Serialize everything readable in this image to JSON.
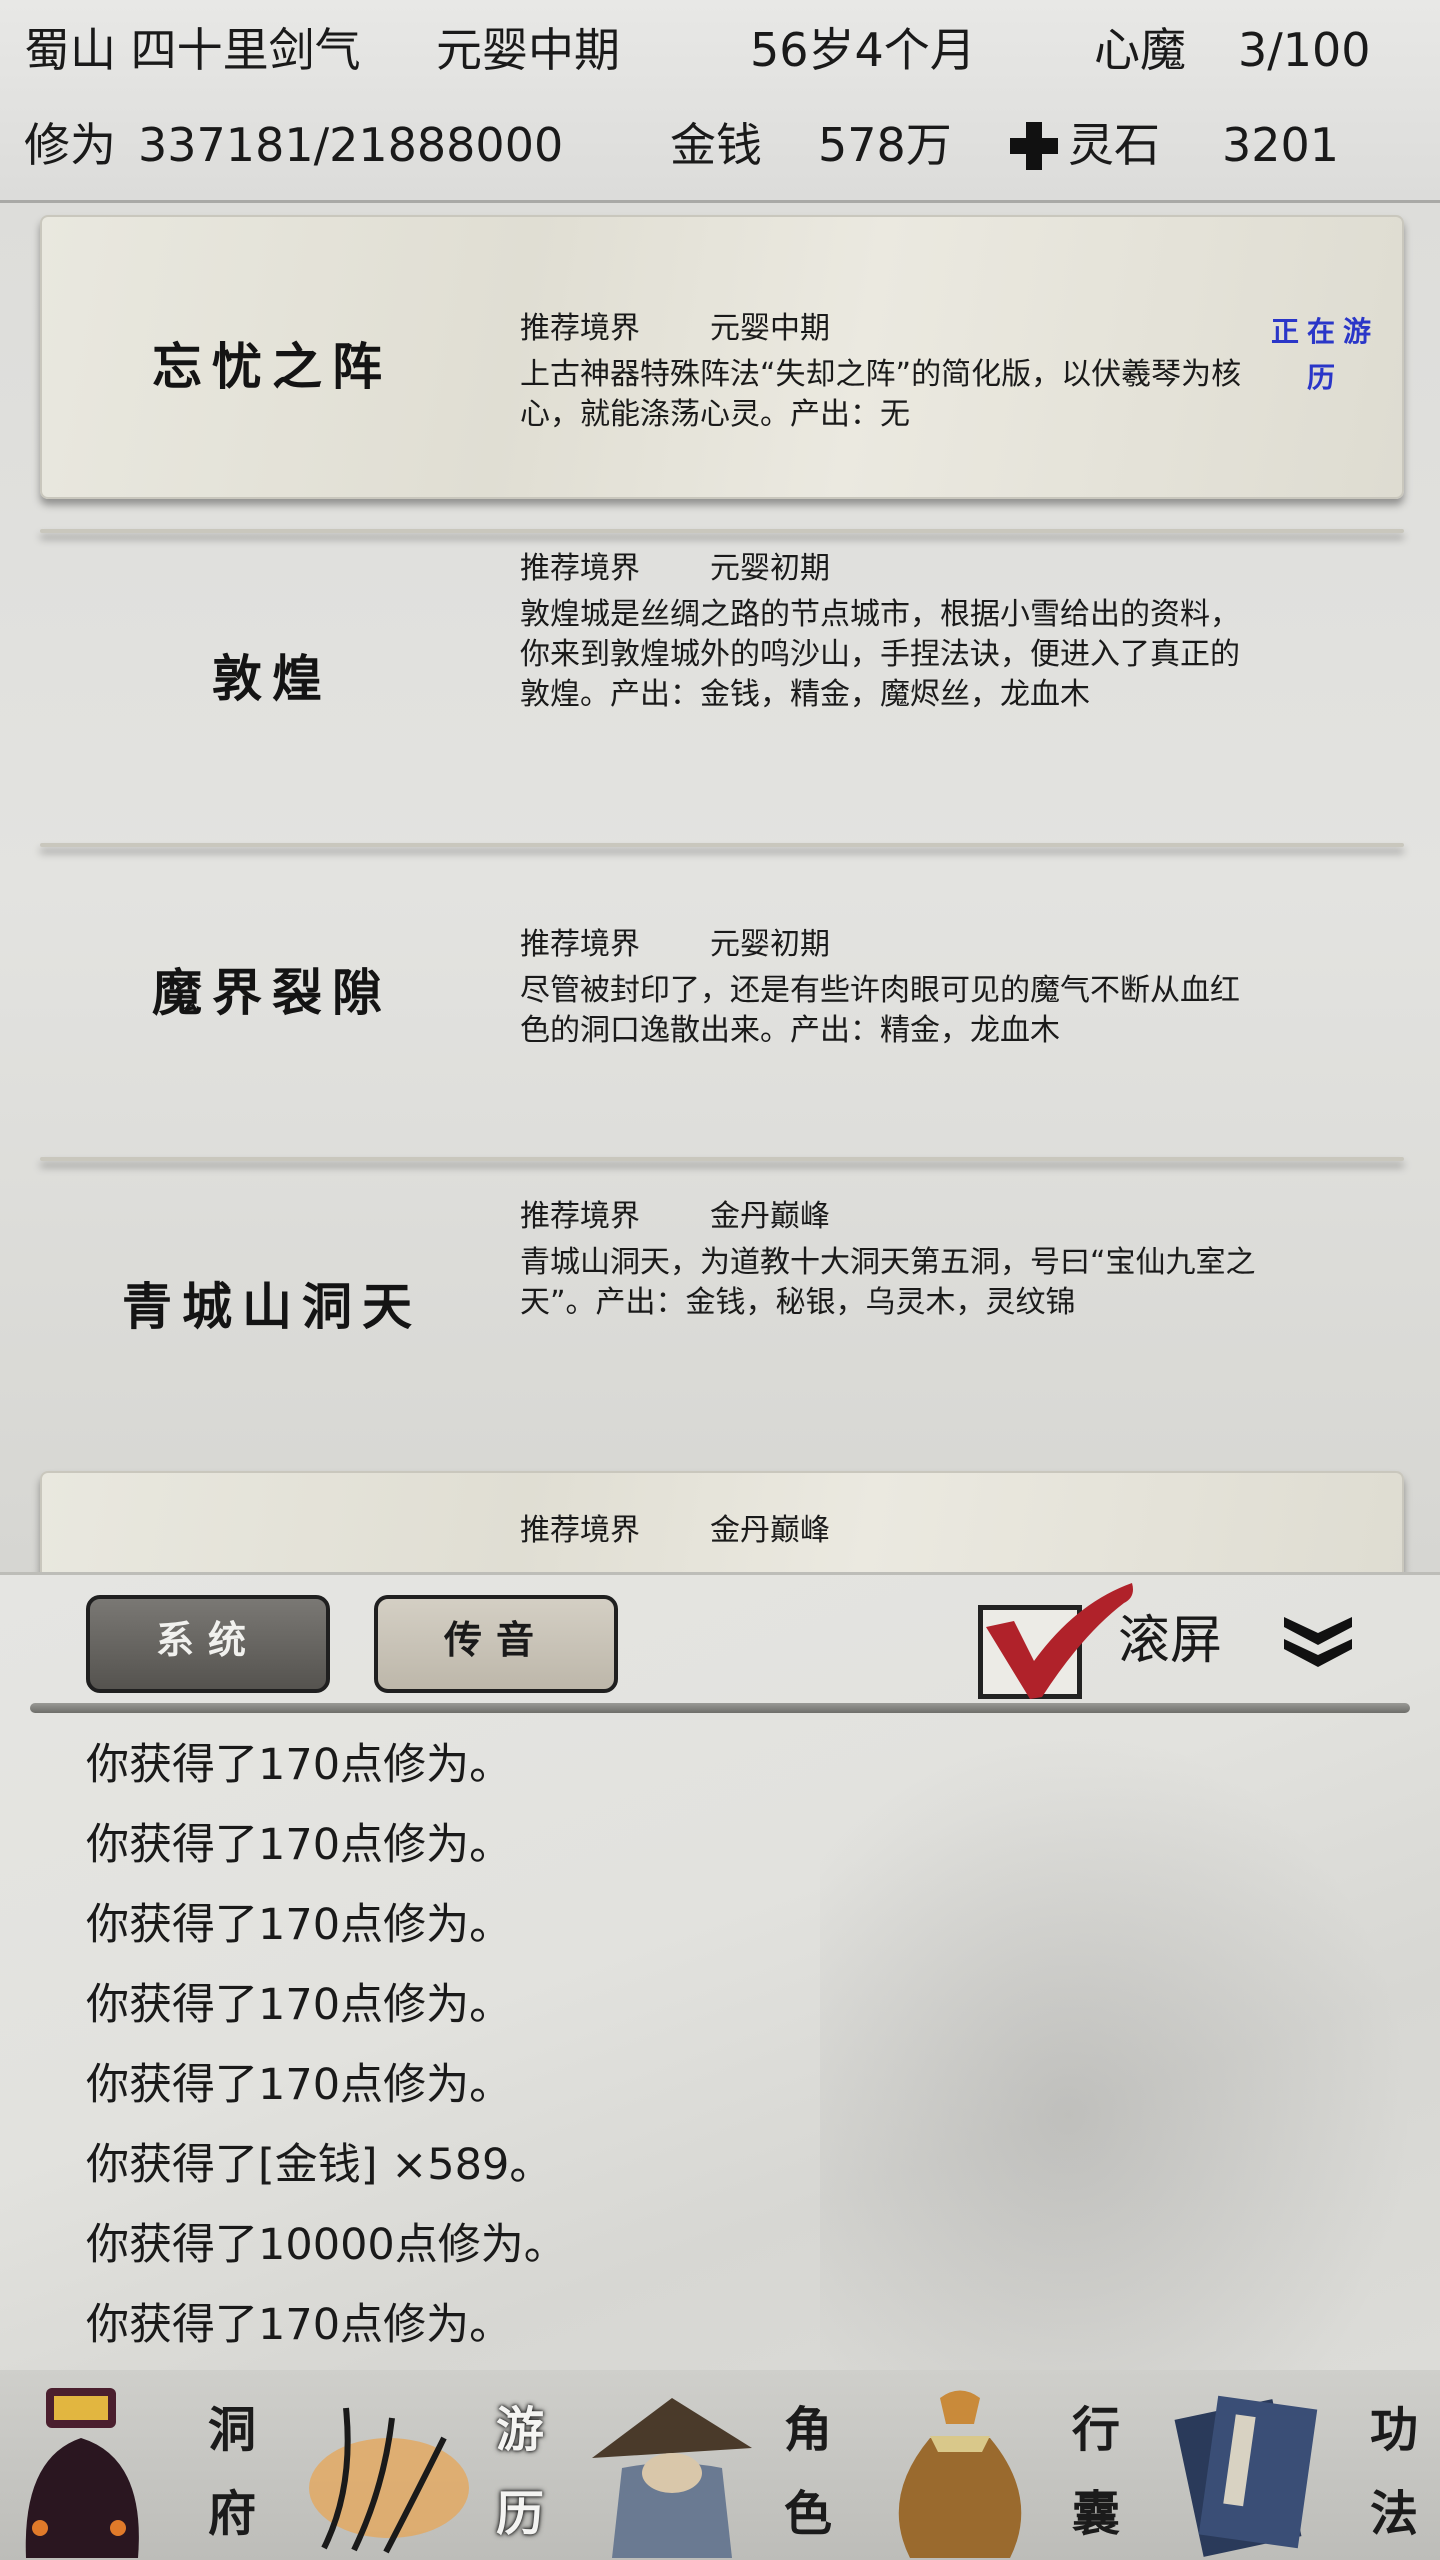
{
  "header": {
    "location": "蜀山 四十里剑气",
    "realm": "元婴中期",
    "age": "56岁4个月",
    "heart_demon_label": "心魔",
    "heart_demon_value": "3/100",
    "cultivation_label": "修为",
    "cultivation_value": "337181/21888000",
    "money_label": "金钱",
    "money_value": "578万",
    "spirit_stone_label": "灵石",
    "spirit_stone_value": "3201"
  },
  "cards": [
    {
      "title": "忘忧之阵",
      "realm_label": "推荐境界",
      "realm_value": "元婴中期",
      "description": "上古神器特殊阵法“失却之阵”的简化版，以伏羲琴为核心，就能涤荡心灵。产出：无",
      "status": "正在游历"
    },
    {
      "title": "敦煌",
      "realm_label": "推荐境界",
      "realm_value": "元婴初期",
      "description": "敦煌城是丝绸之路的节点城市，根据小雪给出的资料，你来到敦煌城外的鸣沙山，手捏法诀，便进入了真正的敦煌。产出：金钱，精金，魔烬丝，龙血木"
    },
    {
      "title": "魔界裂隙",
      "realm_label": "推荐境界",
      "realm_value": "元婴初期",
      "description": "尽管被封印了，还是有些许肉眼可见的魔气不断从血红色的洞口逸散出来。产出：精金，龙血木"
    },
    {
      "title": "青城山洞天",
      "realm_label": "推荐境界",
      "realm_value": "金丹巅峰",
      "description": "青城山洞天，为道教十大洞天第五洞，号曰“宝仙九室之天”。产出：金钱，秘银，乌灵木，灵纹锦"
    },
    {
      "title": "",
      "realm_label": "推荐境界",
      "realm_value": "金丹巅峰",
      "description": ""
    }
  ],
  "log_panel": {
    "tab_system": "系统",
    "tab_message": "传音",
    "scroll_label": "滚屏",
    "scroll_checked": true,
    "lines": [
      "你获得了170点修为。",
      "你获得了170点修为。",
      "你获得了170点修为。",
      "你获得了170点修为。",
      "你获得了170点修为。",
      "你获得了[金钱] ×589。",
      "你获得了10000点修为。",
      "你获得了170点修为。"
    ]
  },
  "nav": {
    "items": [
      {
        "top": "洞",
        "bottom": "府",
        "icon": "cave-mansion-icon"
      },
      {
        "top": "游",
        "bottom": "历",
        "icon": "travel-icon",
        "active": true
      },
      {
        "top": "角",
        "bottom": "色",
        "icon": "character-icon"
      },
      {
        "top": "行",
        "bottom": "囊",
        "icon": "bag-icon"
      },
      {
        "top": "功",
        "bottom": "法",
        "icon": "manual-icon"
      }
    ]
  },
  "colors": {
    "status_blue": "#2a36c8",
    "check_red": "#b0222a",
    "tab_active": "#5f5d59"
  }
}
